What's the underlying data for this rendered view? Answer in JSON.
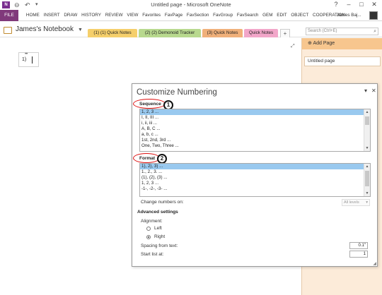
{
  "window": {
    "title": "Untitled page - Microsoft OneNote",
    "app_icon": "N",
    "help": "?",
    "minimize": "–",
    "maximize": "□",
    "close": "✕"
  },
  "ribbon": {
    "file_label": "FILE",
    "tabs": [
      "HOME",
      "INSERT",
      "DRAW",
      "HISTORY",
      "REVIEW",
      "VIEW",
      "Favorites",
      "FavPage",
      "FavSection",
      "FavGroup",
      "FavSearch",
      "GEM",
      "EDIT",
      "OBJECT",
      "COOPERATION"
    ],
    "user": "James Baj..."
  },
  "notebook": {
    "name": "James's Notebook",
    "caret": "▼",
    "sections": [
      {
        "label": "(1) (1) Quick Notes",
        "color": "#f5cf6b"
      },
      {
        "label": "(2) (2) Demonoid Tracker",
        "color": "#b8d98e"
      },
      {
        "label": "(3) Quick Notes",
        "color": "#f0b07a"
      },
      {
        "label": "Quick Notes",
        "color": "#f2a6c9"
      }
    ],
    "add_tab": "+",
    "search_placeholder": "Search (Ctrl+E)"
  },
  "page": {
    "expand_icon": "⤢",
    "outline_grip": "•••",
    "outline_number": "1)"
  },
  "right_panel": {
    "add_page": "Add Page",
    "pages": [
      "Untitled page"
    ]
  },
  "dialog": {
    "title": "Customize Numbering",
    "sequence_label": "Sequence",
    "sequence_items": [
      "1, 2, 3 ...",
      "I, II, III ...",
      "i, ii, iii ...",
      "A, B, C ...",
      "a, b, c ...",
      "1st, 2nd, 3rd ...",
      "One, Two, Three ..."
    ],
    "format_label": "Format",
    "format_items": [
      "1), 2), 3) ...",
      "1., 2., 3. ...",
      "(1), (2), (3) ...",
      "1, 2, 3 ...",
      "-1-, -2-, -3- ..."
    ],
    "change_numbers_label": "Change numbers on:",
    "change_numbers_value": "All levels",
    "advanced_label": "Advanced settings",
    "alignment_label": "Alignment:",
    "align_left": "Left",
    "align_right": "Right",
    "alignment_selected": "Right",
    "spacing_label": "Spacing from text:",
    "spacing_value": "0.1\"",
    "start_label": "Start list at:",
    "start_value": "1",
    "annotation_1": "1",
    "annotation_2": "2"
  },
  "colors": {
    "file_tab": "#80397b",
    "right_panel": "#fcebd9",
    "add_page_bar": "#f7c68e",
    "selection": "#99c9ef",
    "annotation_red": "#d11111"
  }
}
